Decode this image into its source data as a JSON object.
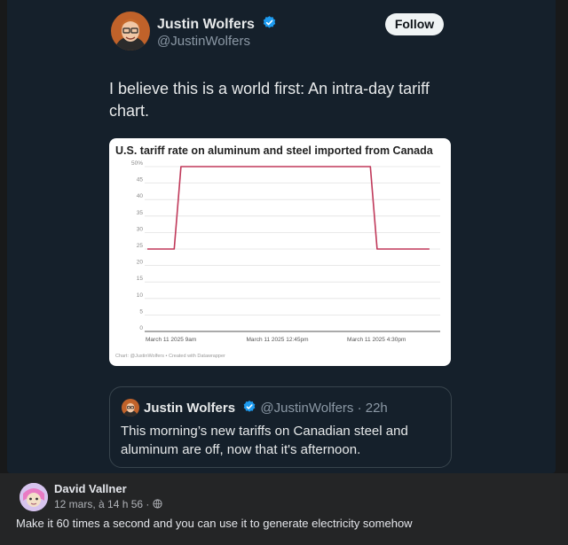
{
  "tweet": {
    "author_name": "Justin Wolfers",
    "author_handle": "@JustinWolfers",
    "follow_label": "Follow",
    "text": "I believe this is a world first: An intra-day tariff chart.",
    "chart": {
      "title": "U.S. tariff rate on aluminum and steel imported from Canada",
      "credit": "Chart: @JustinWolfers • Created with Datawrapper"
    }
  },
  "quote": {
    "author_name": "Justin Wolfers",
    "author_handle": "@JustinWolfers",
    "age": "· 22h",
    "text": "This morning’s new tariffs on Canadian steel and aluminum are off, now that it's afternoon."
  },
  "comment": {
    "author_name": "David Vallner",
    "timestamp": "12 mars, à 14 h 56 ·",
    "text": "Make it 60 times a second and you can use it to generate electricity somehow"
  },
  "colors": {
    "line": "#c0395a",
    "verified": "#1d9bf0"
  },
  "icons": {
    "verified": "verified-badge-icon",
    "globe": "globe-icon"
  },
  "chart_data": {
    "type": "line",
    "title": "U.S. tariff rate on aluminum and steel imported from Canada",
    "x_tick_labels": [
      "March 11 2025 9am",
      "March 11 2025 12:45pm",
      "March 11 2025 4:30pm"
    ],
    "y_tick_labels": [
      "0",
      "5",
      "10",
      "15",
      "20",
      "25",
      "30",
      "35",
      "40",
      "45",
      "50%"
    ],
    "y_ticks": [
      0,
      5,
      10,
      15,
      20,
      25,
      30,
      35,
      40,
      45,
      50
    ],
    "ylim": [
      0,
      50
    ],
    "grid": true,
    "series": [
      {
        "points": [
          {
            "x": 0.1,
            "y": 25
          },
          {
            "x": 1.1,
            "y": 25
          },
          {
            "x": 1.35,
            "y": 50
          },
          {
            "x": 8.4,
            "y": 50
          },
          {
            "x": 8.65,
            "y": 25
          },
          {
            "x": 10.6,
            "y": 25
          }
        ]
      }
    ],
    "x_tick_positions": [
      0,
      3.75,
      7.5
    ],
    "xlim": [
      0,
      11
    ]
  }
}
